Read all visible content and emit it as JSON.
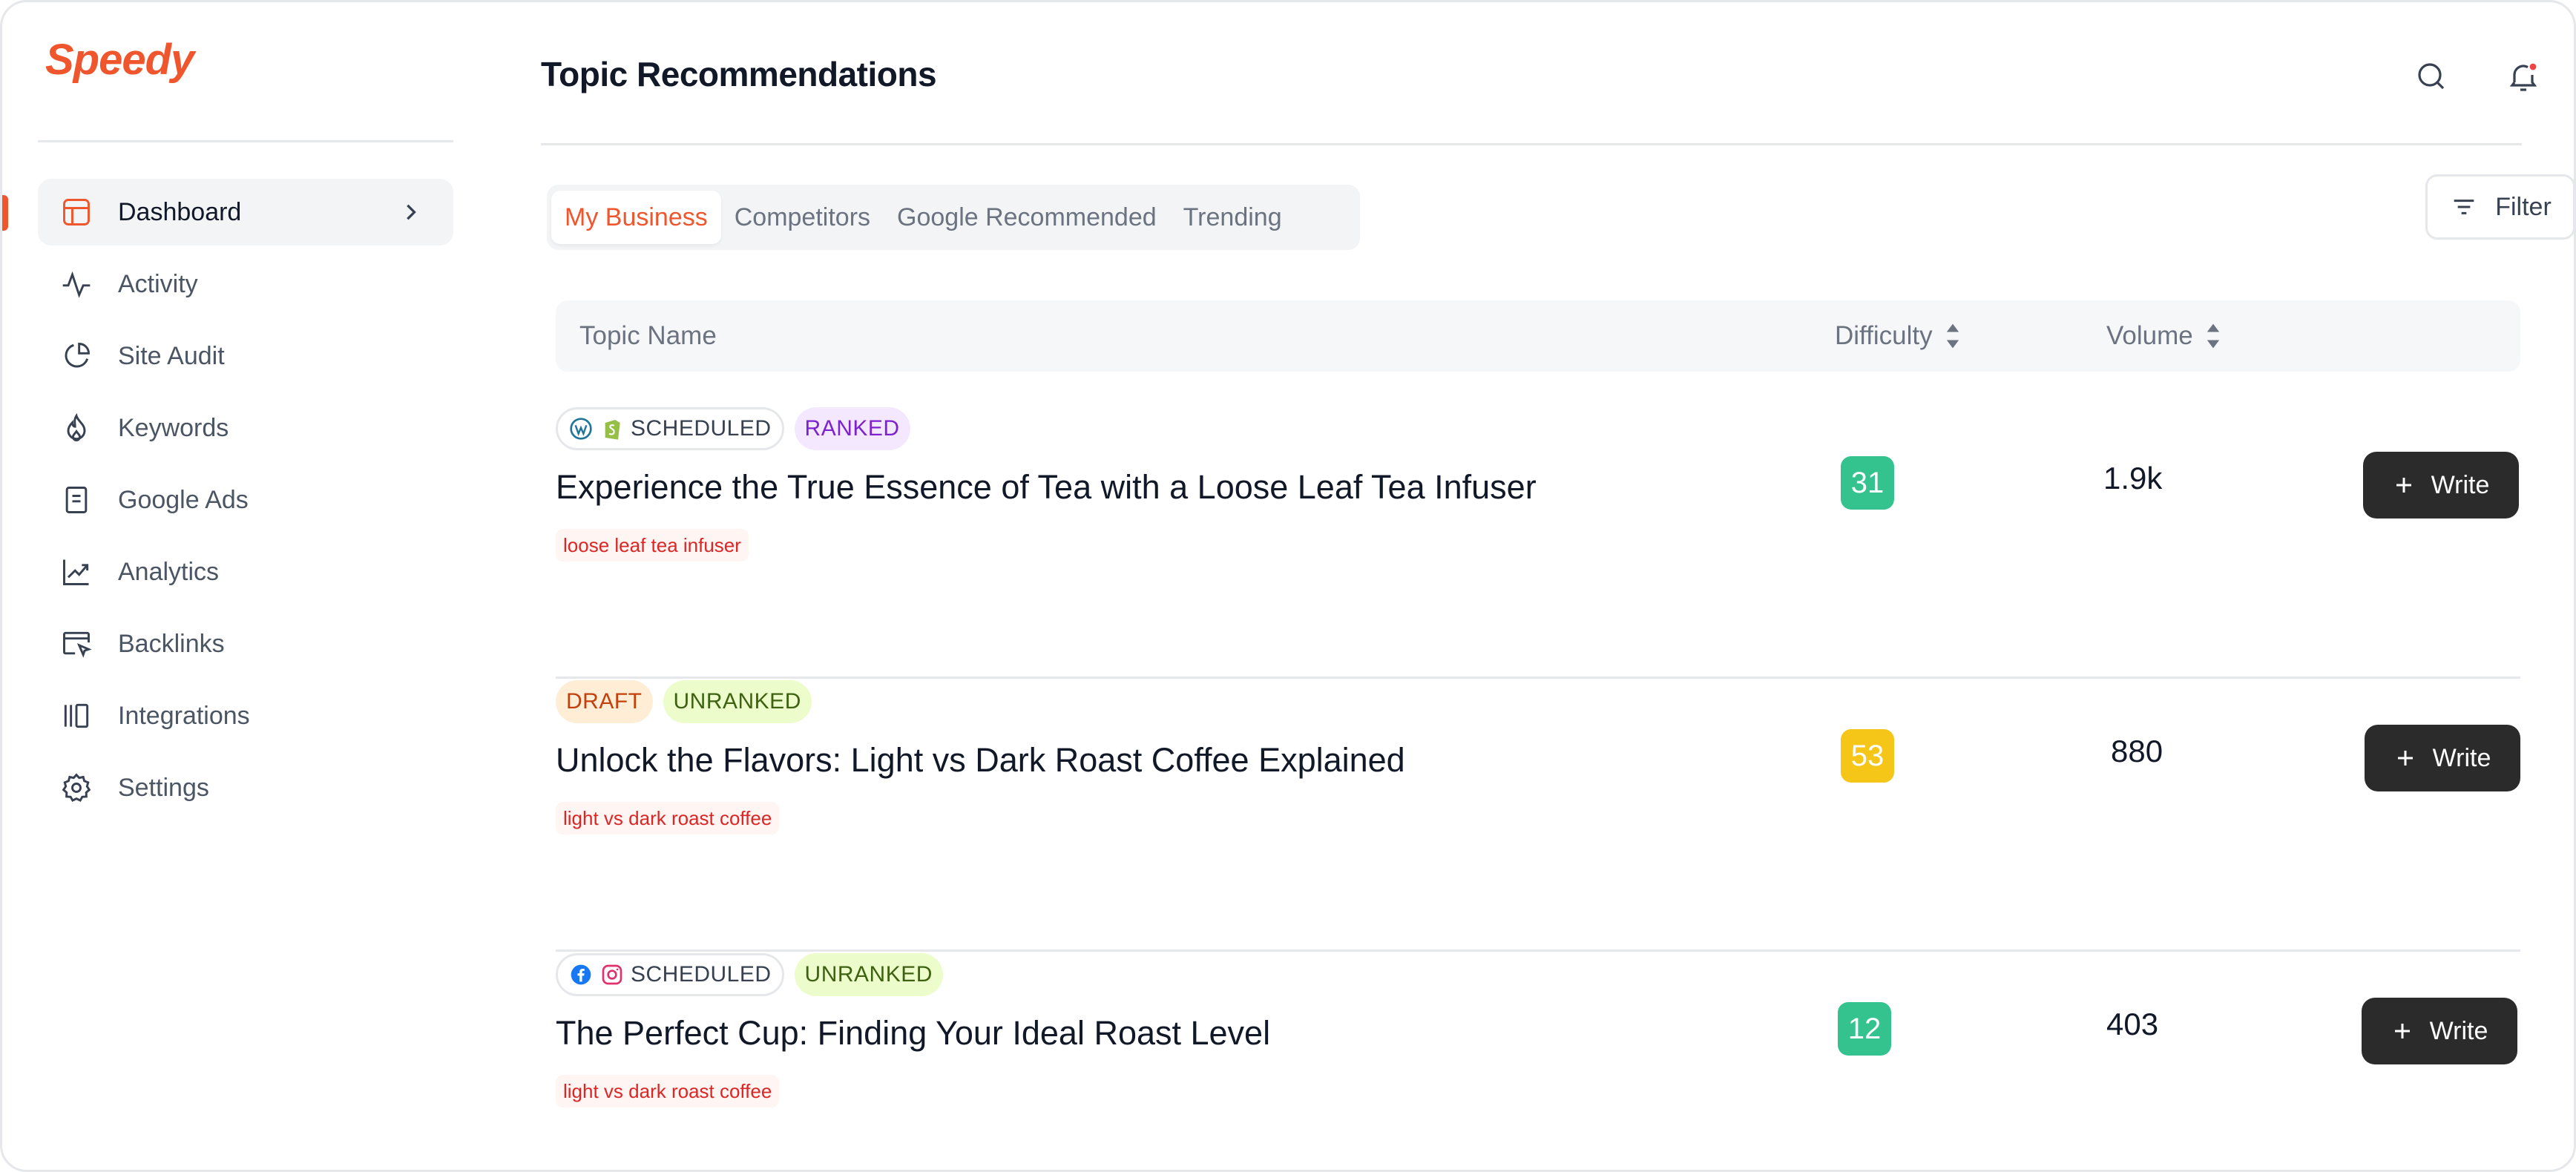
{
  "app": {
    "logo": "Speedy"
  },
  "sidebar": {
    "items": [
      {
        "label": "Dashboard",
        "icon": "dashboard-icon",
        "active": true
      },
      {
        "label": "Activity",
        "icon": "activity-icon"
      },
      {
        "label": "Site Audit",
        "icon": "pie-chart-icon"
      },
      {
        "label": "Keywords",
        "icon": "flame-icon"
      },
      {
        "label": "Google Ads",
        "icon": "document-icon"
      },
      {
        "label": "Analytics",
        "icon": "trend-icon"
      },
      {
        "label": "Backlinks",
        "icon": "browser-cursor-icon"
      },
      {
        "label": "Integrations",
        "icon": "integrations-icon"
      },
      {
        "label": "Settings",
        "icon": "gear-icon"
      }
    ]
  },
  "header": {
    "title": "Topic Recommendations"
  },
  "tabs": [
    {
      "label": "My Business",
      "active": true
    },
    {
      "label": "Competitors"
    },
    {
      "label": "Google Recommended"
    },
    {
      "label": "Trending"
    }
  ],
  "filter": {
    "label": "Filter"
  },
  "table": {
    "columns": {
      "name": "Topic Name",
      "difficulty": "Difficulty",
      "volume": "Volume"
    },
    "rows": [
      {
        "status": "SCHEDULED",
        "rank": "RANKED",
        "title": "Experience the True Essence of Tea with a Loose Leaf Tea Infuser",
        "keyword": "loose leaf tea infuser",
        "difficulty": "31",
        "volume": "1.9k",
        "action": "Write"
      },
      {
        "status": "DRAFT",
        "rank": "UNRANKED",
        "title": "Unlock the Flavors: Light vs Dark Roast Coffee Explained",
        "keyword": "light vs dark roast coffee",
        "difficulty": "53",
        "volume": "880",
        "action": "Write"
      },
      {
        "status": "SCHEDULED",
        "rank": "UNRANKED",
        "title": "The Perfect Cup: Finding Your Ideal Roast Level",
        "keyword": "light vs dark roast coffee",
        "difficulty": "12",
        "volume": "403",
        "action": "Write"
      }
    ]
  },
  "colors": {
    "brand": "#f0562d",
    "easy": "#34c38f",
    "medium": "#f5c518",
    "button": "#2b2b2b"
  }
}
